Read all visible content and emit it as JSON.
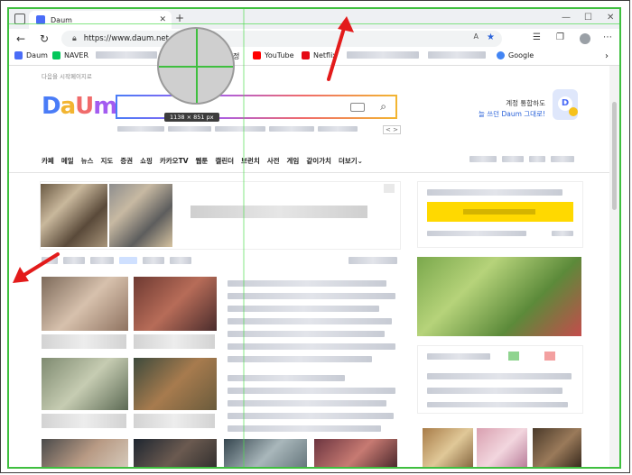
{
  "browser": {
    "tab_title": "Daum",
    "new_tab": "+",
    "url": "https://www.daum.net",
    "minimize": "—",
    "maximize": "☐",
    "close": "✕"
  },
  "bookmarks": [
    {
      "label": "Daum",
      "color": "#4a6cf7"
    },
    {
      "label": "NAVER",
      "color": "#03c75a"
    },
    {
      "label": "YouTube",
      "color": "#ff0000"
    },
    {
      "label": "Netflix",
      "color": "#e50914"
    },
    {
      "label": "Google",
      "color": "#4285f4"
    }
  ],
  "bookmark_partial": "정",
  "page": {
    "start_page": "다음을 시작페이지로",
    "logo_letters": [
      {
        "ch": "D",
        "color": "#4a7cf7"
      },
      {
        "ch": "a",
        "color": "#f2b531"
      },
      {
        "ch": "U",
        "color": "#f06b6b"
      },
      {
        "ch": "m",
        "color": "#a35cf0"
      }
    ],
    "size_badge": "1138 × 851 px",
    "account_line1": "계정 통합하도",
    "account_line2": "늘 쓰던 Daum 그대로!",
    "menu": [
      "카페",
      "메일",
      "뉴스",
      "지도",
      "증권",
      "쇼핑",
      "카카오TV",
      "웹툰",
      "캘린더",
      "브런치",
      "사전",
      "게임",
      "같이가치",
      "더보기"
    ],
    "menu_more_arrow": "⌄",
    "search_nav": "< >"
  },
  "colors": {
    "guide_green": "#3fbf3f",
    "annotation_red": "#e31b1b",
    "promo_yellow": "#ffd900"
  }
}
